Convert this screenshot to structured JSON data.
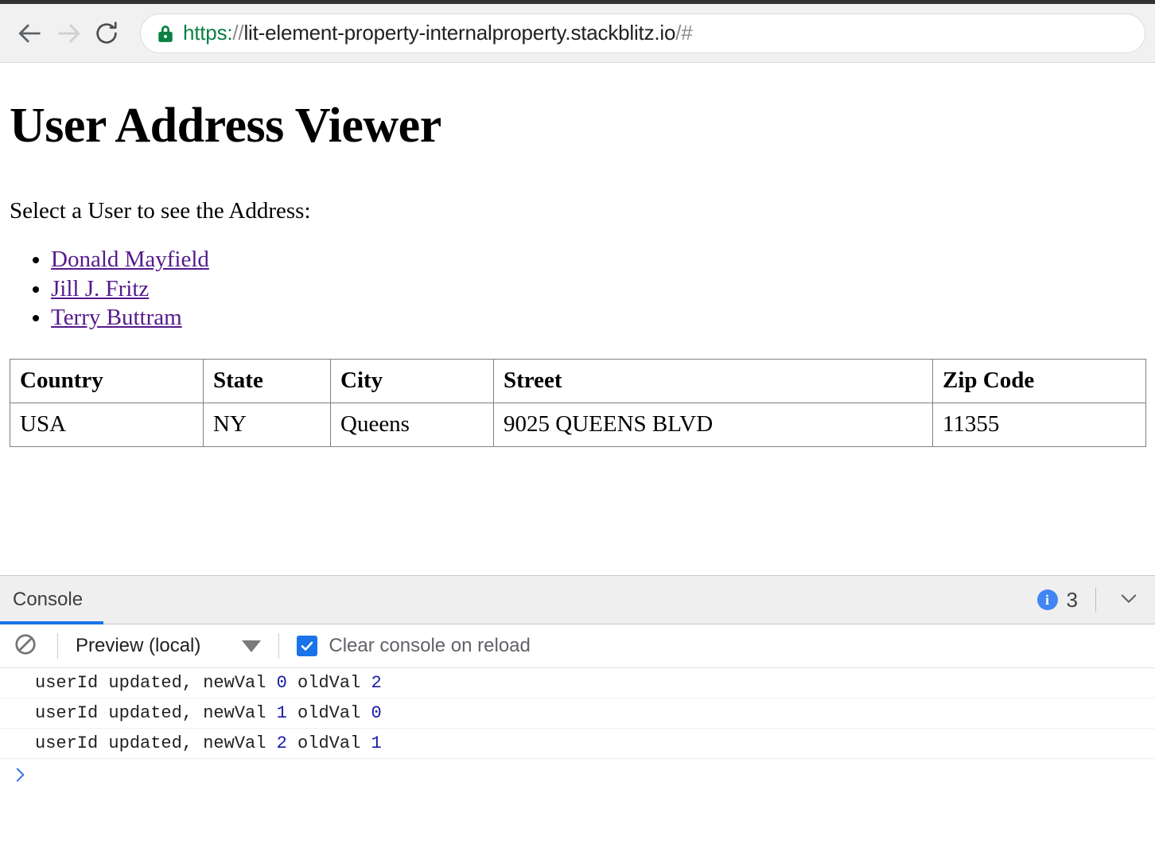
{
  "browser": {
    "back_label": "Back",
    "forward_label": "Forward",
    "reload_label": "Reload",
    "security_icon": "lock-icon",
    "url": {
      "scheme": "https:",
      "separator": "//",
      "host": "lit-element-property-internalproperty.stackblitz.io",
      "path": "/#",
      "full": "https://lit-element-property-internalproperty.stackblitz.io/#"
    },
    "colors": {
      "secure_green": "#0b8043",
      "toolbar_bg": "#f1f1f1"
    }
  },
  "page": {
    "title": "User Address Viewer",
    "prompt": "Select a User to see the Address:",
    "users": [
      {
        "name": "Donald Mayfield"
      },
      {
        "name": "Jill J. Fritz"
      },
      {
        "name": "Terry Buttram"
      }
    ],
    "link_color": "#551a8b",
    "table": {
      "headers": [
        "Country",
        "State",
        "City",
        "Street",
        "Zip Code"
      ],
      "rows": [
        [
          "USA",
          "NY",
          "Queens",
          "9025 QUEENS BLVD",
          "11355"
        ]
      ]
    }
  },
  "console": {
    "tab_label": "Console",
    "active_tab_color": "#1a73e8",
    "info_badge_glyph": "i",
    "info_count": "3",
    "collapse_icon": "chevron-down-icon",
    "toolbar": {
      "clear_icon": "block-icon",
      "context_label": "Preview (local)",
      "context_caret_icon": "triangle-down-icon",
      "clear_on_reload_label": "Clear console on reload",
      "clear_on_reload_checked": true,
      "checkbox_color": "#1a73e8"
    },
    "logs": [
      {
        "prefix": "userId updated, newVal ",
        "new_val": "0",
        "mid": " oldVal ",
        "old_val": "2"
      },
      {
        "prefix": "userId updated, newVal ",
        "new_val": "1",
        "mid": " oldVal ",
        "old_val": "0"
      },
      {
        "prefix": "userId updated, newVal ",
        "new_val": "2",
        "mid": " oldVal ",
        "old_val": "1"
      }
    ],
    "prompt_icon": "chevron-right-icon",
    "prompt_color": "#3b78e7"
  }
}
